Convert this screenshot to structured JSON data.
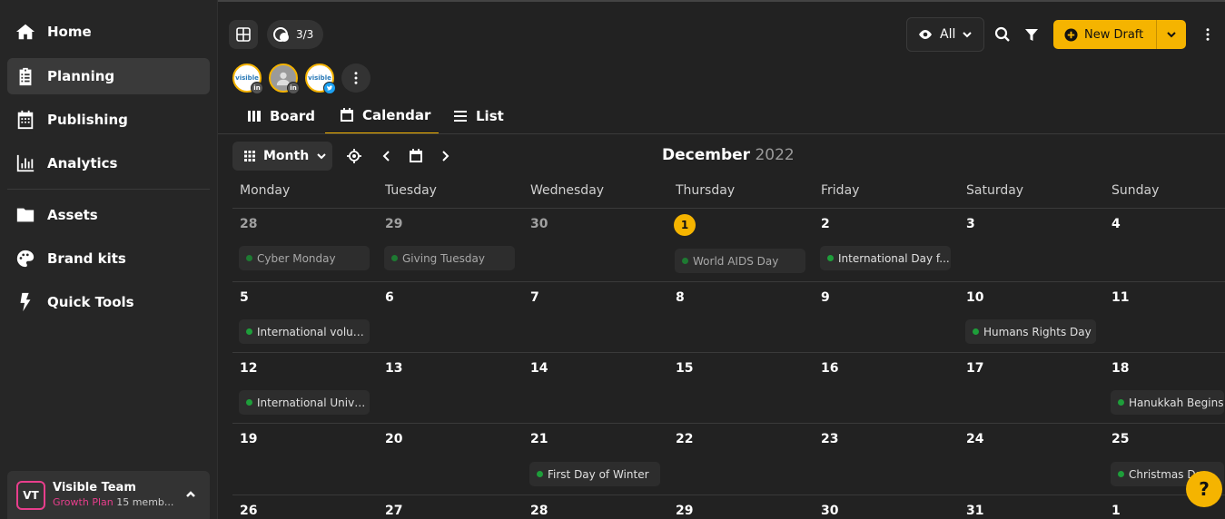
{
  "sidebar": {
    "items": [
      {
        "label": "Home",
        "icon": "home-icon"
      },
      {
        "label": "Planning",
        "icon": "clipboard-icon",
        "active": true
      },
      {
        "label": "Publishing",
        "icon": "calendar-icon"
      },
      {
        "label": "Analytics",
        "icon": "bar-chart-icon"
      },
      {
        "label": "Assets",
        "icon": "folder-icon"
      },
      {
        "label": "Brand kits",
        "icon": "palette-icon"
      },
      {
        "label": "Quick Tools",
        "icon": "bolt-icon"
      }
    ],
    "team": {
      "initials": "VT",
      "name": "Visible Team",
      "plan": "Growth Plan",
      "members": "15 memb..."
    }
  },
  "toolbar": {
    "counter": "3/3",
    "profiles": [
      {
        "label": "visible",
        "network": "in"
      },
      {
        "label": "",
        "network": "in"
      },
      {
        "label": "visible",
        "network": "tw"
      }
    ],
    "filter_label": "All",
    "new_draft_label": "New Draft"
  },
  "view_tabs": [
    {
      "label": "Board",
      "icon": "board-icon"
    },
    {
      "label": "Calendar",
      "icon": "calendar-icon",
      "active": true
    },
    {
      "label": "List",
      "icon": "list-icon"
    }
  ],
  "calendar": {
    "view_label": "Month",
    "month": "December",
    "year": "2022",
    "weekdays": [
      "Monday",
      "Tuesday",
      "Wednesday",
      "Thursday",
      "Friday",
      "Saturday",
      "Sunday"
    ],
    "weeks": [
      [
        {
          "day": "28",
          "muted": true,
          "event": "Cyber Monday",
          "past": true
        },
        {
          "day": "29",
          "muted": true,
          "event": "Giving Tuesday",
          "past": true
        },
        {
          "day": "30",
          "muted": true,
          "event": ""
        },
        {
          "day": "1",
          "today": true,
          "event": "World AIDS Day",
          "past": true
        },
        {
          "day": "2",
          "event": "International Day f..."
        },
        {
          "day": "3",
          "event": ""
        },
        {
          "day": "4",
          "event": ""
        }
      ],
      [
        {
          "day": "5",
          "event": "International volun..."
        },
        {
          "day": "6",
          "event": ""
        },
        {
          "day": "7",
          "event": ""
        },
        {
          "day": "8",
          "event": ""
        },
        {
          "day": "9",
          "event": ""
        },
        {
          "day": "10",
          "event": "Humans Rights Day"
        },
        {
          "day": "11",
          "event": ""
        }
      ],
      [
        {
          "day": "12",
          "event": "International Unive..."
        },
        {
          "day": "13",
          "event": ""
        },
        {
          "day": "14",
          "event": ""
        },
        {
          "day": "15",
          "event": ""
        },
        {
          "day": "16",
          "event": ""
        },
        {
          "day": "17",
          "event": ""
        },
        {
          "day": "18",
          "event": "Hanukkah Begins"
        }
      ],
      [
        {
          "day": "19",
          "event": ""
        },
        {
          "day": "20",
          "event": ""
        },
        {
          "day": "21",
          "event": "First Day of Winter"
        },
        {
          "day": "22",
          "event": ""
        },
        {
          "day": "23",
          "event": ""
        },
        {
          "day": "24",
          "event": ""
        },
        {
          "day": "25",
          "event": "Christmas Day"
        }
      ],
      [
        {
          "day": "26",
          "event": ""
        },
        {
          "day": "27",
          "event": ""
        },
        {
          "day": "28",
          "event": ""
        },
        {
          "day": "29",
          "event": ""
        },
        {
          "day": "30",
          "event": ""
        },
        {
          "day": "31",
          "event": ""
        },
        {
          "day": "1",
          "event": ""
        }
      ]
    ]
  },
  "help_label": "?",
  "colors": {
    "accent": "#f5b400",
    "event_dot": "#1e9e3a",
    "plan": "#e83e8c",
    "background": "#222222"
  }
}
